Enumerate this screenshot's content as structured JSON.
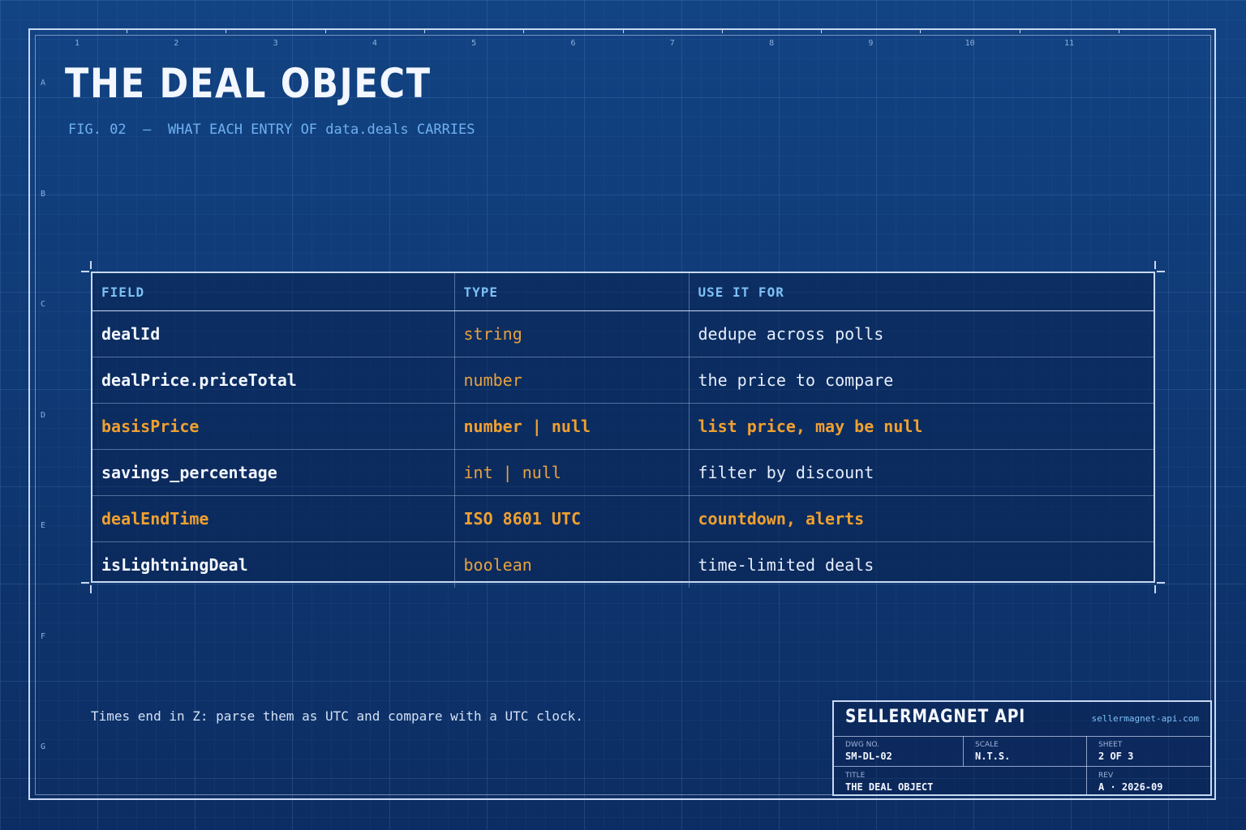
{
  "title": "THE DEAL OBJECT",
  "subtitle": "FIG. 02  —  WHAT EACH ENTRY OF data.deals CARRIES",
  "grid": {
    "columns": [
      "1",
      "2",
      "3",
      "4",
      "5",
      "6",
      "7",
      "8",
      "9",
      "10",
      "11"
    ],
    "rows": [
      "A",
      "B",
      "C",
      "D",
      "E",
      "F",
      "G"
    ]
  },
  "table": {
    "headers": [
      "FIELD",
      "TYPE",
      "USE IT FOR"
    ],
    "rows": [
      {
        "field": "dealId",
        "type": "string",
        "use": "dedupe across polls",
        "highlight": false
      },
      {
        "field": "dealPrice.priceTotal",
        "type": "number",
        "use": "the price to compare",
        "highlight": false
      },
      {
        "field": "basisPrice",
        "type": "number | null",
        "use": "list price, may be null",
        "highlight": true
      },
      {
        "field": "savings_percentage",
        "type": "int | null",
        "use": "filter by discount",
        "highlight": false
      },
      {
        "field": "dealEndTime",
        "type": "ISO 8601 UTC",
        "use": "countdown, alerts",
        "highlight": true
      },
      {
        "field": "isLightningDeal",
        "type": "boolean",
        "use": "time-limited deals",
        "highlight": false
      }
    ]
  },
  "note": "Times end in Z: parse them as UTC and compare with a UTC clock.",
  "title_block": {
    "brand": "SELLERMAGNET API",
    "url": "sellermagnet-api.com",
    "dwg_label": "DWG NO.",
    "dwg_value": "SM-DL-02",
    "scale_label": "SCALE",
    "scale_value": "N.T.S.",
    "sheet_label": "SHEET",
    "sheet_value": "2 OF 3",
    "title_label": "TITLE",
    "title_value": "THE DEAL OBJECT",
    "rev_label": "REV",
    "rev_value": "A · 2026-09"
  },
  "colors": {
    "background": "#0f3a78",
    "line": "#c9d9f2",
    "header_text": "#7dc0f5",
    "accent_orange": "#f0a030",
    "subtitle": "#6fb0f0"
  }
}
